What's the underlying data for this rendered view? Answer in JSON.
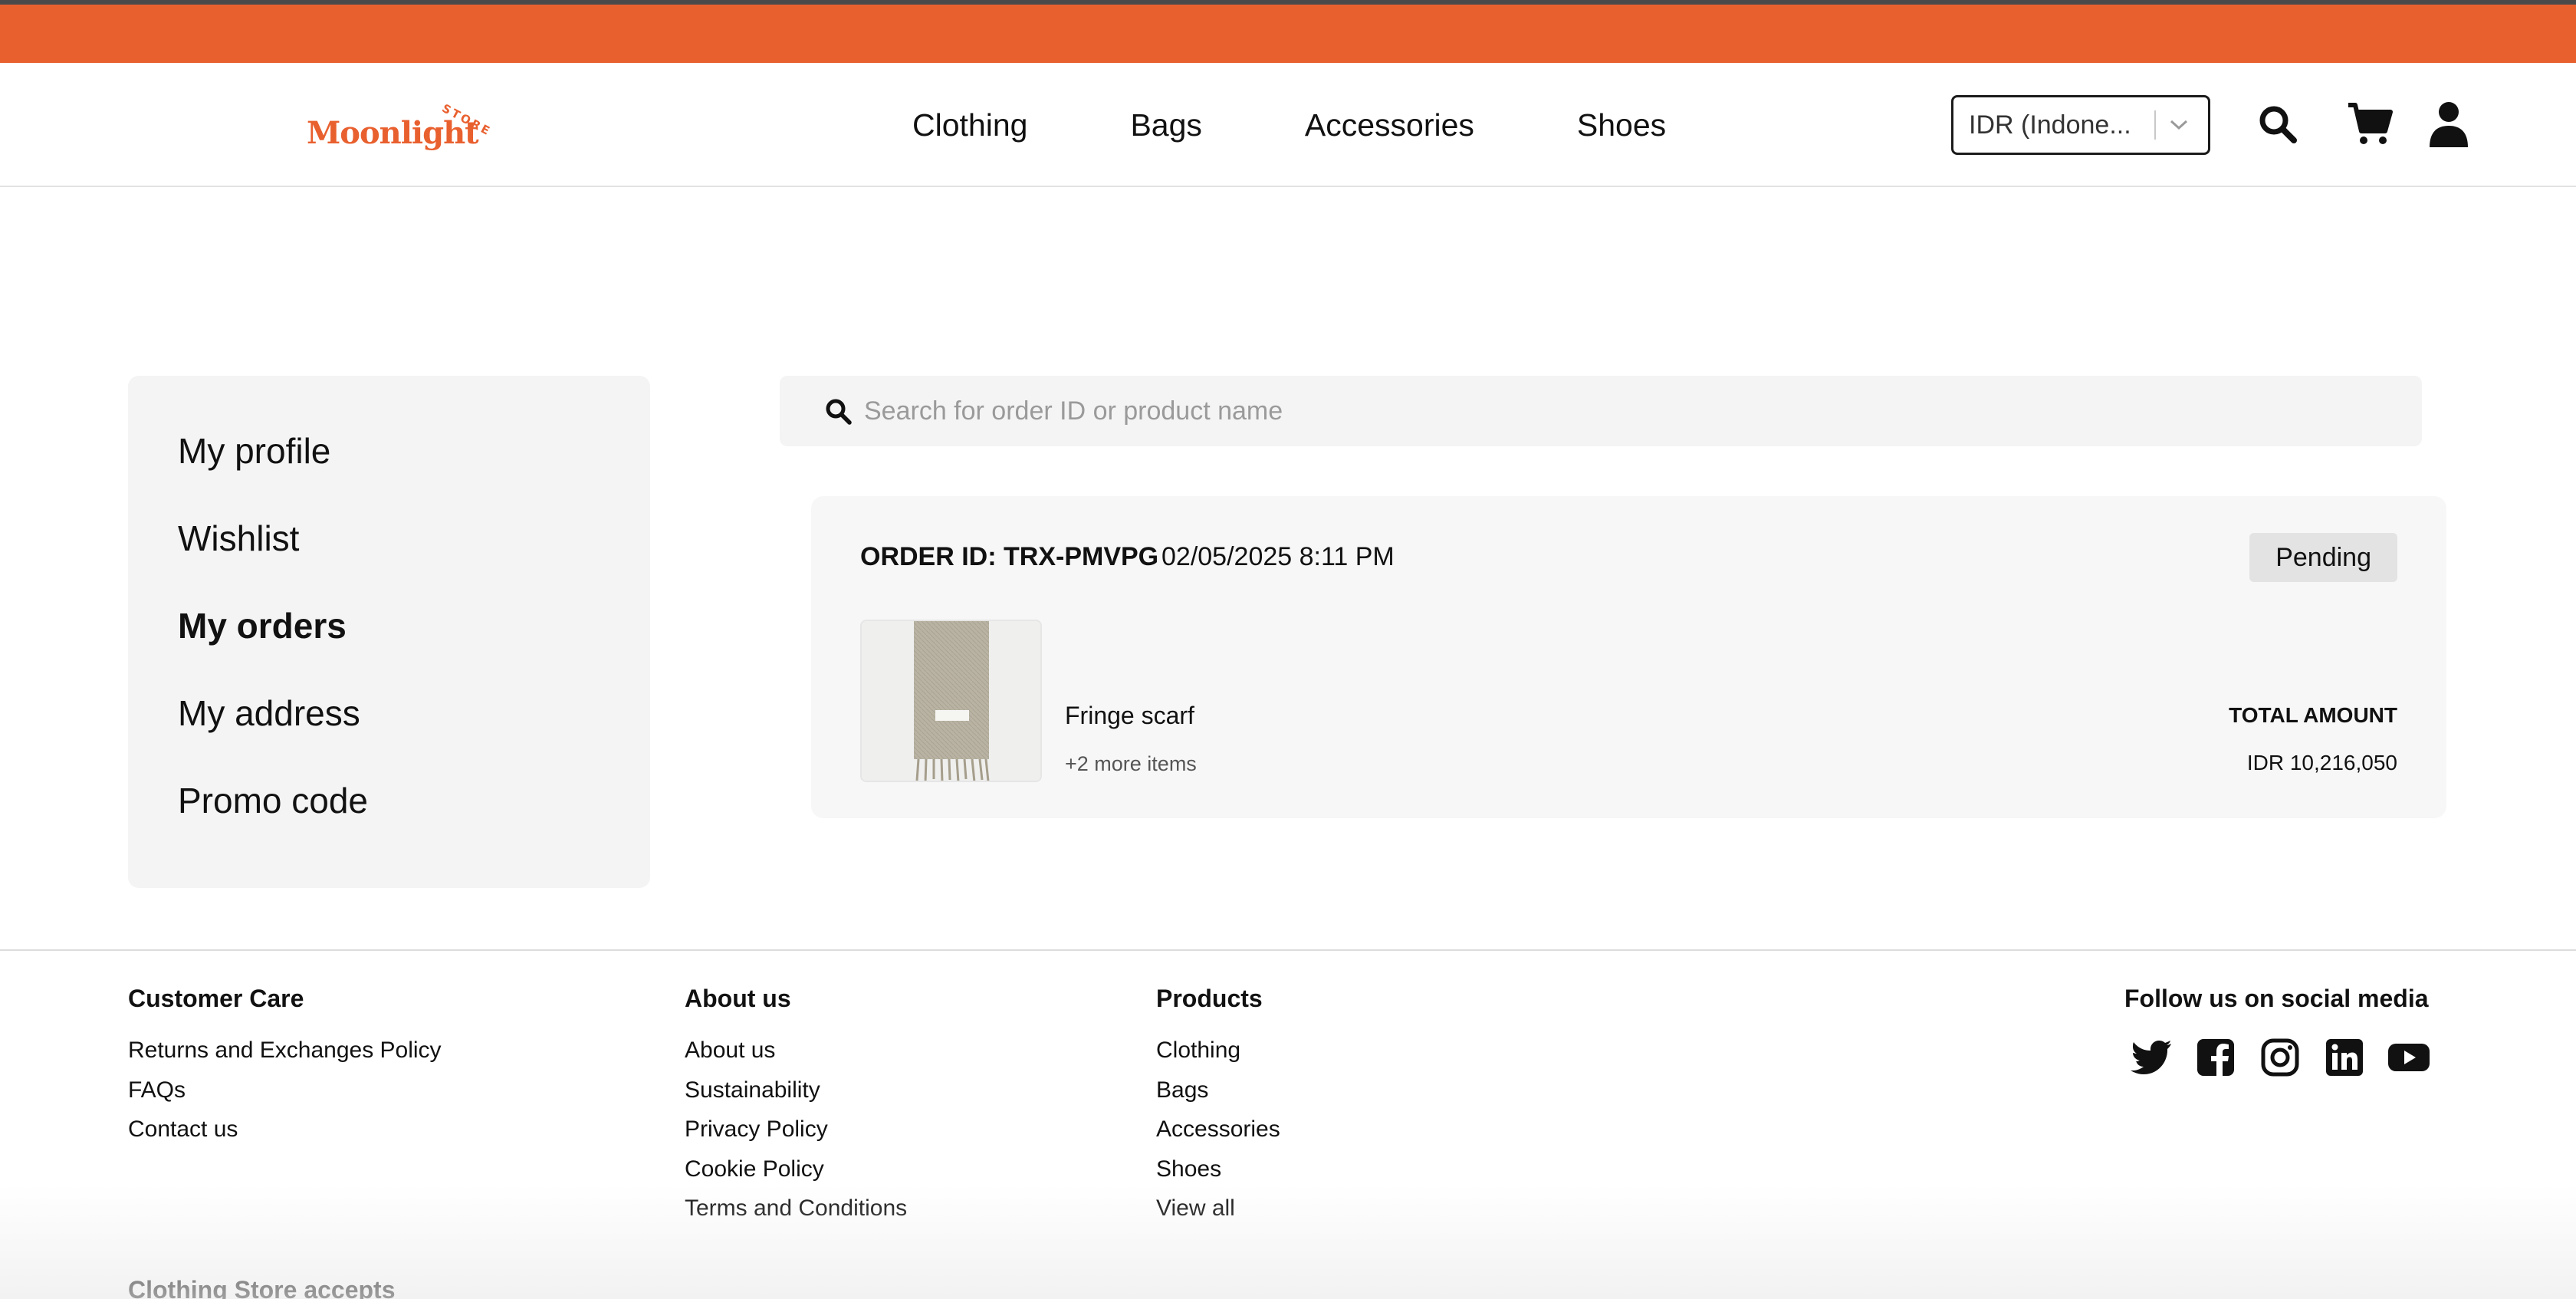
{
  "brand": {
    "logo_text": "Moonlight",
    "logo_sup": "STORE",
    "accent_color": "#e9602f"
  },
  "nav": {
    "items": [
      "Clothing",
      "Bags",
      "Accessories",
      "Shoes"
    ]
  },
  "header": {
    "currency_value": "IDR (Indone...",
    "icons": [
      "search-icon",
      "cart-icon",
      "user-icon"
    ]
  },
  "sidebar": {
    "items": [
      {
        "label": "My profile",
        "active": false
      },
      {
        "label": "Wishlist",
        "active": false
      },
      {
        "label": "My orders",
        "active": true
      },
      {
        "label": "My address",
        "active": false
      },
      {
        "label": "Promo code",
        "active": false
      }
    ]
  },
  "search": {
    "placeholder": "Search for order ID or product name",
    "value": ""
  },
  "orders": [
    {
      "id_label": "ORDER ID: TRX-PMVPG",
      "date": "02/05/2025 8:11 PM",
      "status": "Pending",
      "product_name": "Fringe scarf",
      "more_items": "+2 more items",
      "total_label": "TOTAL AMOUNT",
      "total_value": "IDR 10,216,050"
    }
  ],
  "footer": {
    "customer_care": {
      "title": "Customer Care",
      "links": [
        "Returns and Exchanges Policy",
        "FAQs",
        "Contact us"
      ]
    },
    "about": {
      "title": "About us",
      "links": [
        "About us",
        "Sustainability",
        "Privacy Policy",
        "Cookie Policy",
        "Terms and Conditions"
      ]
    },
    "products": {
      "title": "Products",
      "links": [
        "Clothing",
        "Bags",
        "Accessories",
        "Shoes",
        "View all"
      ]
    },
    "social": {
      "title": "Follow us on social media",
      "icons": [
        "twitter-icon",
        "facebook-icon",
        "instagram-icon",
        "linkedin-icon",
        "youtube-icon"
      ]
    },
    "accepts": "Clothing Store accepts"
  }
}
